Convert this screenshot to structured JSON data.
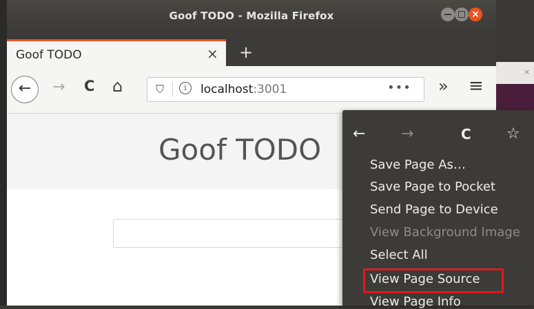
{
  "window": {
    "title": "Goof TODO - Mozilla Firefox",
    "close_glyph": "×"
  },
  "tabs": [
    {
      "label": "Goof TODO",
      "close_glyph": "×"
    }
  ],
  "new_tab_glyph": "+",
  "navbar": {
    "back_glyph": "←",
    "forward_glyph": "→",
    "reload_glyph": "C",
    "home_glyph": "⌂",
    "shield_glyph": "⛉",
    "info_glyph": "i",
    "url_host": "localhost",
    "url_port": ":3001",
    "page_actions_glyph": "•••",
    "overflow_glyph": "»",
    "menu_glyph": "≡"
  },
  "page": {
    "title": "Goof TODO",
    "input_placeholder": ""
  },
  "context_menu": {
    "nav": {
      "back_glyph": "←",
      "forward_glyph": "→",
      "reload_glyph": "C",
      "bookmark_glyph": "☆"
    },
    "items": [
      {
        "label": "Save Page As…",
        "enabled": true
      },
      {
        "label": "Save Page to Pocket",
        "enabled": true
      },
      {
        "label": "Send Page to Device",
        "enabled": true
      },
      {
        "label": "View Background Image",
        "enabled": false
      },
      {
        "label": "Select All",
        "enabled": true
      },
      {
        "label": "View Page Source",
        "enabled": true,
        "highlighted": true
      },
      {
        "label": "View Page Info",
        "enabled": true
      }
    ]
  },
  "background_window": {
    "tab_close_glyph": "×"
  },
  "colors": {
    "accent": "#e95420",
    "highlight_border": "#e01820",
    "menu_bg": "#3c3b37"
  }
}
